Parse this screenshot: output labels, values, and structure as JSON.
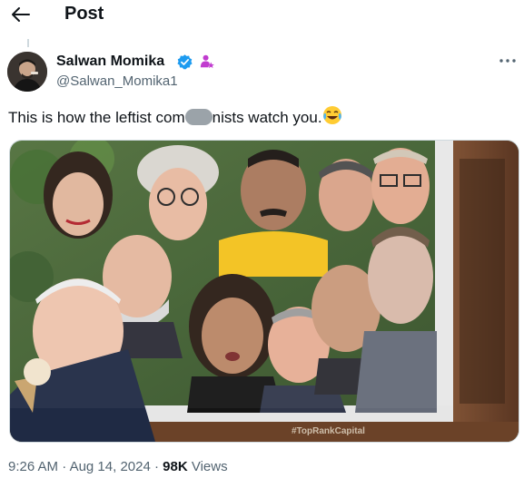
{
  "header": {
    "title": "Post",
    "back_icon": "arrow-left-icon"
  },
  "author": {
    "display_name": "Salwan Momika",
    "handle": "@Salwan_Momika1",
    "verified_color": "#1d9bf0",
    "affiliate_color": "#c13ccf"
  },
  "tweet": {
    "text_before": "This is how the leftist com",
    "text_after": "nists watch you.",
    "emoji": "face-with-tears-of-joy"
  },
  "media": {
    "watermark": "#TopRankCapital"
  },
  "meta": {
    "time": "9:26 AM",
    "sep1": "·",
    "date": "Aug 14, 2024",
    "sep2": "·",
    "views_count": "98K",
    "views_label": "Views"
  },
  "colors": {
    "text": "#0f1419",
    "secondary": "#536471",
    "border": "#cfd9de"
  }
}
